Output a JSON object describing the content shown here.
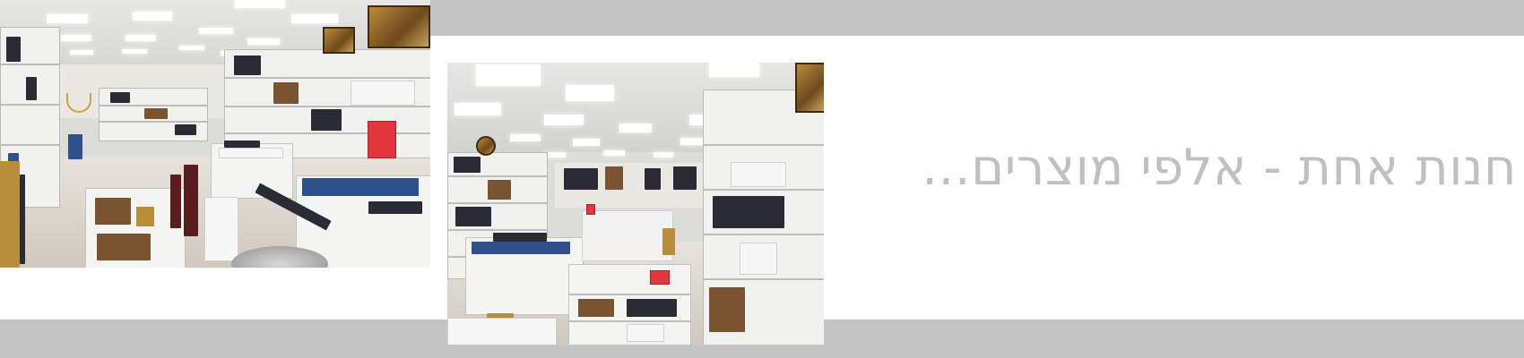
{
  "banner": {
    "headline": "חנות אחת - אלפי מוצרים...",
    "colors": {
      "band": "#c4c4c4",
      "headline": "#c0c0c0",
      "background": "#ffffff"
    }
  },
  "photos": [
    {
      "subject": "store-aisle-wide"
    },
    {
      "subject": "store-aisle-center-display"
    }
  ]
}
